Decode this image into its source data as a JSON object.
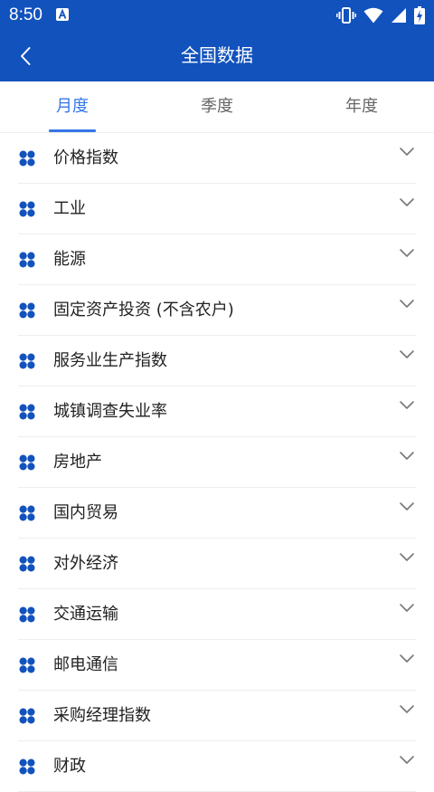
{
  "status_bar": {
    "time": "8:50",
    "notification_icon": "a-notification-icon",
    "icons": [
      "vibrate-icon",
      "wifi-icon",
      "signal-icon",
      "battery-charging-icon"
    ]
  },
  "header": {
    "title": "全国数据",
    "back_icon": "chevron-left-icon",
    "background_color": "#1252bd"
  },
  "tabs": [
    {
      "label": "月度",
      "active": true
    },
    {
      "label": "季度",
      "active": false
    },
    {
      "label": "年度",
      "active": false
    }
  ],
  "accent_color": "#3576e8",
  "list_icon": "clover-icon",
  "expand_icon": "chevron-down-icon",
  "categories": [
    "价格指数",
    "工业",
    "能源",
    "固定资产投资 (不含农户)",
    "服务业生产指数",
    "城镇调查失业率",
    "房地产",
    "国内贸易",
    "对外经济",
    "交通运输",
    "邮电通信",
    "采购经理指数",
    "财政"
  ]
}
